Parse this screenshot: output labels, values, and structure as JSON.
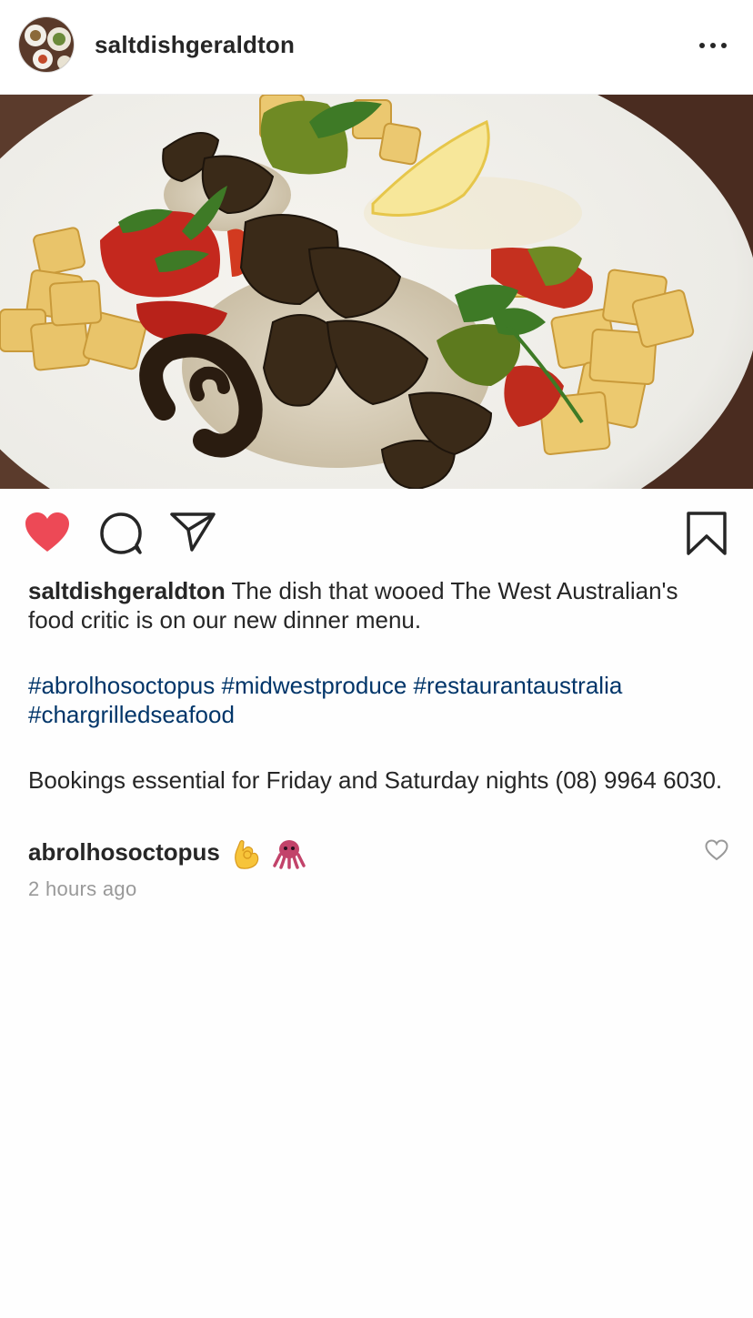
{
  "post": {
    "username": "saltdishgeraldton",
    "more_icon": "more-horizontal-icon",
    "photo_alt": "",
    "liked": true,
    "like_color": "#ed4956",
    "icons": {
      "like": "heart-filled-icon",
      "comment": "comment-bubble-icon",
      "share": "send-paper-plane-icon",
      "save": "bookmark-icon"
    }
  },
  "caption": {
    "username": "saltdishgeraldton",
    "text": " The dish that wooed The West Australian's food critic is on our new dinner menu.",
    "hashtags": [
      "#abrolhosoctopus",
      "#midwestproduce",
      "#restaurantaustralia",
      "#chargrilledseafood"
    ],
    "bookings": "Bookings essential for Friday and Saturday nights (08) 9964 6030."
  },
  "comment": {
    "username": "abrolhosoctopus",
    "emojis": [
      "ok-hand-emoji",
      "octopus-emoji"
    ],
    "like_icon": "heart-outline-icon"
  },
  "timestamp": "2 hours ago",
  "colors": {
    "hashtag": "#003569",
    "text": "#262626",
    "muted": "#999999"
  }
}
